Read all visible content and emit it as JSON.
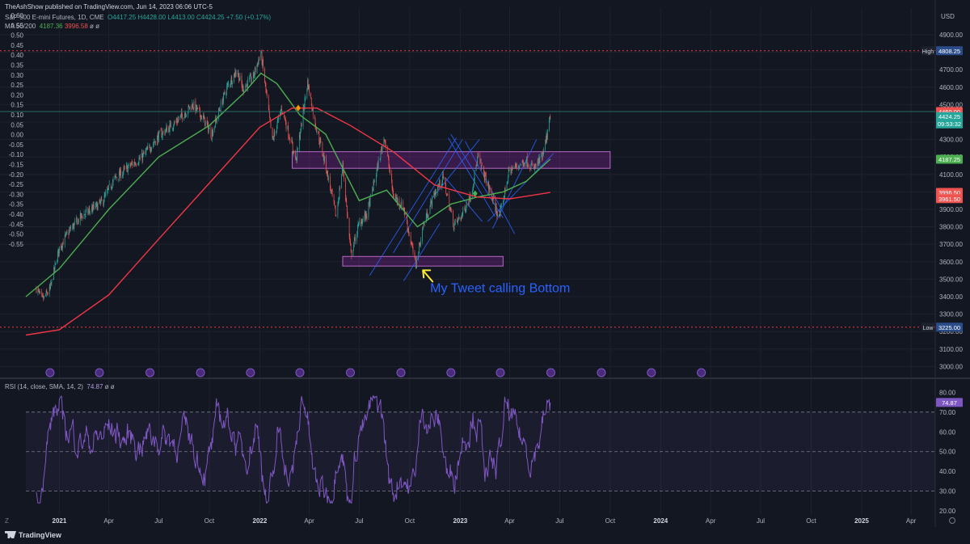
{
  "header": {
    "publisher": "TheAshShow published on TradingView.com, Jun 14, 2023 06:06 UTC-5",
    "symbol": "S&P 500 E-mini Futures, 1D, CME",
    "ohlc_o": "O4417.25",
    "ohlc_h": "H4428.00",
    "ohlc_l": "L4413.00",
    "ohlc_c": "C4424.25",
    "change": "+7.50 (+0.17%)",
    "ma_label": "MA 50/200",
    "ma50": "4187.36",
    "ma200": "3996.58",
    "ma_extra": "ø ø",
    "rsi_label": "RSI (14, close, SMA, 14, 2)",
    "rsi_value": "74.87",
    "rsi_extra": "ø ø"
  },
  "colors": {
    "background": "#131722",
    "grid": "#1e222d",
    "candle_up": "#26a69a",
    "candle_down": "#ef5350",
    "ma50": "#4caf50",
    "ma200": "#f23645",
    "zone": "#9c27b0",
    "rsi": "#7e57c2",
    "trendline": "#2962ff",
    "annotation_text": "#2962ff",
    "arrow": "#ffeb3b",
    "hilo_line": "#f23645"
  },
  "annotation": {
    "text": "My Tweet calling Bottom",
    "arrow_icon": "arrow-pointing-up-left"
  },
  "branding": {
    "name": "TradingView",
    "icon": "tradingview-logo-icon",
    "axis_icon": "Z"
  },
  "price_badges": {
    "currency": "USD",
    "high_label": "High",
    "high_value": "4808.25",
    "low_label": "Low",
    "low_value": "3225.00",
    "last_price": "4424.25",
    "countdown": "09:53:32",
    "ref_price": "4460.00",
    "ma50_badge": "4187.25",
    "ma200_badge": "3996.50",
    "badge_3961": "3961.50",
    "rsi_badge": "74.87"
  },
  "chart_data": [
    {
      "type": "candlestick",
      "symbol": "S&P 500 E-mini Futures",
      "timeframe": "1D",
      "x_ticks": [
        "2021",
        "Apr",
        "Jul",
        "Oct",
        "2022",
        "Apr",
        "Jul",
        "Oct",
        "2023",
        "Apr",
        "Jul",
        "Oct",
        "2024",
        "Apr",
        "Jul",
        "Oct",
        "2025",
        "Apr"
      ],
      "y_ticks_right": [
        "4900.00",
        "4800.00",
        "4700.00",
        "4600.00",
        "4500.00",
        "4400.00",
        "4300.00",
        "4200.00",
        "4100.00",
        "4000.00",
        "3900.00",
        "3800.00",
        "3700.00",
        "3600.00",
        "3500.00",
        "3400.00",
        "3300.00",
        "3200.00",
        "3100.00",
        "3000.00"
      ],
      "y_ticks_left": [
        "0.60",
        "0.55",
        "0.50",
        "0.45",
        "0.40",
        "0.35",
        "0.30",
        "0.25",
        "0.20",
        "0.15",
        "0.10",
        "0.05",
        "0.00",
        "-0.05",
        "-0.10",
        "-0.15",
        "-0.20",
        "-0.25",
        "-0.30",
        "-0.35",
        "-0.40",
        "-0.45",
        "-0.50",
        "-0.55"
      ],
      "ylim": [
        2960,
        4960
      ],
      "price_path": {
        "dates": [
          "2020-11-20",
          "2020-12-01",
          "2020-12-15",
          "2021-01-01",
          "2021-01-20",
          "2021-02-10",
          "2021-03-01",
          "2021-03-20",
          "2021-04-10",
          "2021-05-10",
          "2021-06-01",
          "2021-07-01",
          "2021-08-01",
          "2021-09-01",
          "2021-09-20",
          "2021-10-05",
          "2021-11-01",
          "2021-11-20",
          "2021-12-01",
          "2021-12-20",
          "2022-01-03",
          "2022-01-24",
          "2022-02-10",
          "2022-03-08",
          "2022-03-29",
          "2022-04-10",
          "2022-05-01",
          "2022-05-20",
          "2022-06-01",
          "2022-06-16",
          "2022-07-01",
          "2022-07-15",
          "2022-08-16",
          "2022-09-01",
          "2022-09-20",
          "2022-10-12",
          "2022-10-25",
          "2022-11-15",
          "2022-12-01",
          "2022-12-20",
          "2023-01-01",
          "2023-01-20",
          "2023-02-02",
          "2023-02-20",
          "2023-03-13",
          "2023-03-31",
          "2023-04-15",
          "2023-05-01",
          "2023-05-15",
          "2023-06-01",
          "2023-06-14"
        ],
        "values": [
          3450,
          3380,
          3440,
          3680,
          3780,
          3860,
          3900,
          3940,
          4070,
          4150,
          4200,
          4320,
          4400,
          4500,
          4420,
          4330,
          4590,
          4700,
          4590,
          4660,
          4800,
          4290,
          4480,
          4180,
          4630,
          4420,
          4150,
          3860,
          4150,
          3640,
          3820,
          3870,
          4320,
          3980,
          3910,
          3580,
          3800,
          3990,
          4080,
          3810,
          3850,
          3980,
          4200,
          4040,
          3850,
          4120,
          4150,
          4180,
          4130,
          4210,
          4424.25
        ]
      },
      "high": {
        "date": "2022-01-03",
        "value": 4808.25
      },
      "low": {
        "date": "2020-11-01",
        "value": 3225.0
      },
      "series": [
        {
          "name": "MA 50",
          "points": [
            {
              "x": "2020-11-01",
              "y": 3400
            },
            {
              "x": "2021-01-01",
              "y": 3560
            },
            {
              "x": "2021-04-01",
              "y": 3900
            },
            {
              "x": "2021-07-01",
              "y": 4200
            },
            {
              "x": "2021-10-01",
              "y": 4380
            },
            {
              "x": "2021-12-01",
              "y": 4560
            },
            {
              "x": "2022-01-03",
              "y": 4680
            },
            {
              "x": "2022-02-01",
              "y": 4620
            },
            {
              "x": "2022-03-15",
              "y": 4440
            },
            {
              "x": "2022-05-01",
              "y": 4330
            },
            {
              "x": "2022-07-01",
              "y": 3950
            },
            {
              "x": "2022-08-20",
              "y": 4010
            },
            {
              "x": "2022-10-15",
              "y": 3800
            },
            {
              "x": "2022-12-15",
              "y": 3930
            },
            {
              "x": "2023-02-01",
              "y": 3970
            },
            {
              "x": "2023-03-20",
              "y": 4000
            },
            {
              "x": "2023-05-01",
              "y": 4060
            },
            {
              "x": "2023-06-14",
              "y": 4187.36
            }
          ]
        },
        {
          "name": "MA 200",
          "points": [
            {
              "x": "2020-11-01",
              "y": 3180
            },
            {
              "x": "2021-01-01",
              "y": 3210
            },
            {
              "x": "2021-04-01",
              "y": 3410
            },
            {
              "x": "2021-07-01",
              "y": 3730
            },
            {
              "x": "2021-10-01",
              "y": 4050
            },
            {
              "x": "2022-01-01",
              "y": 4370
            },
            {
              "x": "2022-03-01",
              "y": 4480
            },
            {
              "x": "2022-04-15",
              "y": 4480
            },
            {
              "x": "2022-06-15",
              "y": 4380
            },
            {
              "x": "2022-09-01",
              "y": 4230
            },
            {
              "x": "2022-11-15",
              "y": 4040
            },
            {
              "x": "2023-02-01",
              "y": 3970
            },
            {
              "x": "2023-04-01",
              "y": 3960
            },
            {
              "x": "2023-06-14",
              "y": 3996.58
            }
          ]
        }
      ],
      "zones": [
        {
          "from_date": "2022-03-01",
          "to_date": "2023-10-01",
          "price_top": 4230,
          "price_bottom": 4135
        },
        {
          "from_date": "2022-06-01",
          "to_date": "2023-03-20",
          "price_top": 3630,
          "price_bottom": 3575
        }
      ]
    },
    {
      "type": "line",
      "name": "RSI (14, close, SMA, 14, 2)",
      "y_ticks": [
        "80.00",
        "70.00",
        "60.00",
        "50.00",
        "40.00",
        "30.00",
        "20.00"
      ],
      "ylim": [
        18,
        83
      ],
      "levels": [
        70,
        50,
        30
      ],
      "last_value": 74.87
    }
  ]
}
